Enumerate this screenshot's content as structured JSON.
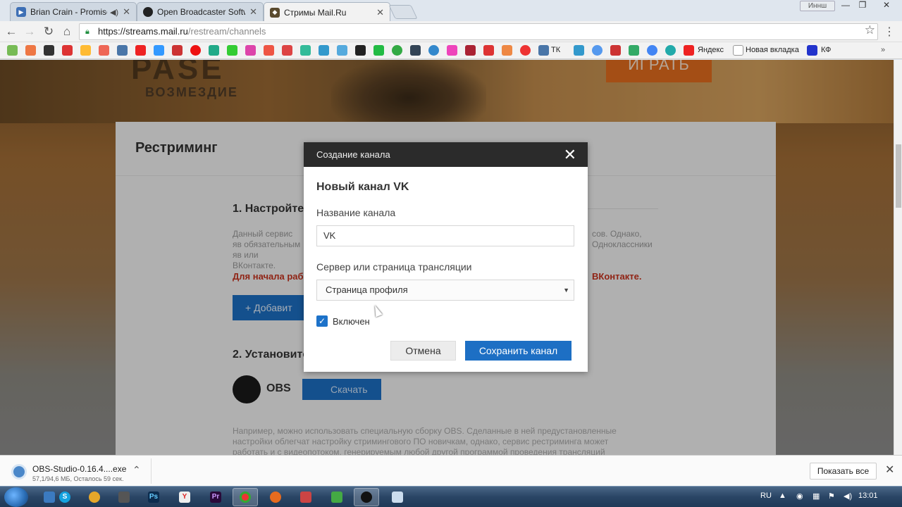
{
  "browser": {
    "tabs": [
      {
        "title": "Brian Crain - Promise",
        "active": false,
        "audio": true,
        "favicon_color": "#3d6fb5"
      },
      {
        "title": "Open Broadcaster Softw",
        "active": false,
        "favicon_color": "#222222"
      },
      {
        "title": "Стримы Mail.Ru",
        "active": true,
        "favicon_color": "#5a4a2e"
      }
    ],
    "profile_label": "Иннш",
    "window_controls": {
      "minimize": "—",
      "maximize": "❐",
      "close": "✕"
    },
    "url": {
      "host": "https://streams.mail.ru",
      "path": "/restream/channels"
    },
    "bookmarks_text": [
      {
        "label": "ТК",
        "icon": "vk-icon"
      },
      {
        "label": "Яндекс",
        "icon": "yandex-icon"
      },
      {
        "label": "Новая вкладка",
        "icon": "page-icon"
      },
      {
        "label": "КФ",
        "icon": "f-icon"
      }
    ]
  },
  "page": {
    "hero": {
      "logo": "PASE",
      "subtitle": "ВОЗМЕЗДИЕ",
      "play_button": "ИГРАТЬ"
    },
    "title": "Рестриминг",
    "section1_title": "1. Настройте",
    "section1_text": "Данный сервис яв обязательным яв или ВКонтакте.",
    "section1_text_right": "сов. Однако, Одноклассники",
    "warning_left": "Для начала раб",
    "warning_right": "ВКонтакте.",
    "add_button": "Добавит",
    "section2_title": "2. Установите",
    "obs_label": "OBS",
    "download_button": "Скачать",
    "section2_text": "Например, можно использовать специальную сборку OBS. Сделанные в ней предустановленные настройки облегчат настройку стримингового ПО новичкам, однако, сервис рестриминга может работать и с видеопотоком, генерируемым любой другой программой проведения трансляций"
  },
  "modal": {
    "header": "Создание канала",
    "title": "Новый канал VK",
    "name_label": "Название канала",
    "name_value": "VK",
    "server_label": "Сервер или страница трансляции",
    "server_value": "Страница профиля",
    "enabled_label": "Включен",
    "enabled_checked": true,
    "cancel": "Отмена",
    "save": "Сохранить канал"
  },
  "downloads": {
    "file_name": "OBS-Studio-0.16.4....exe",
    "progress": "57,1/94,6 МБ, Осталось 59 сек.",
    "show_all": "Показать все"
  },
  "taskbar": {
    "language": "RU",
    "time": "13:01"
  },
  "colors": {
    "accent": "#1d6fc4",
    "warning": "#c8321e",
    "modal_header": "#2b2b2b"
  }
}
